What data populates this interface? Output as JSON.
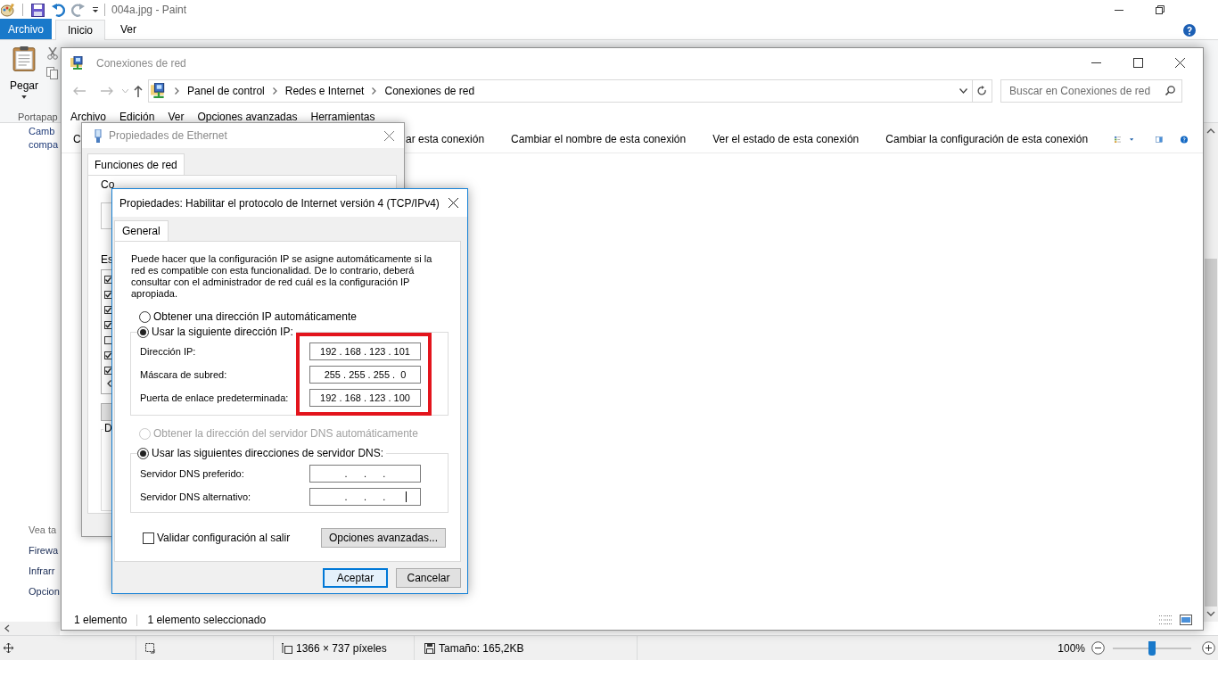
{
  "paint": {
    "title": "004a.jpg - Paint",
    "tabs": [
      {
        "label": "Archivo",
        "kind": "file"
      },
      {
        "label": "Inicio",
        "kind": "tab",
        "selected": true
      },
      {
        "label": "Ver",
        "kind": "tab",
        "selected": false
      }
    ],
    "ribbon": {
      "paste_label": "Pegar",
      "group_label": "Portapap"
    },
    "status_bar": {
      "dimensions": "1366 × 737 píxeles",
      "size": "Tamaño: 165,2KB",
      "zoom": {
        "reading": "100%",
        "level": 0.5
      }
    }
  },
  "background_window": {
    "top_lines": [
      "Camb",
      "compa"
    ],
    "see_also": {
      "heading": "Vea ta",
      "links": [
        "Firewa",
        "Infrarr",
        "Opcion"
      ]
    }
  },
  "explorer": {
    "title": "Conexiones de red",
    "breadcrumb": [
      "Panel de control",
      "Redes e Internet",
      "Conexiones de red"
    ],
    "search": {
      "placeholder": "Buscar en Conexiones de red"
    },
    "menu": [
      "Archivo",
      "Edición",
      "Ver",
      "Opciones avanzadas",
      "Herramientas"
    ],
    "commands": [
      "C",
      "ar esta conexión",
      "Cambiar el nombre de esta conexión",
      "Ver el estado de esta conexión",
      "Cambiar la configuración de esta conexión"
    ],
    "status": [
      "1 elemento",
      "1 elemento seleccionado"
    ]
  },
  "ethernet_dialog": {
    "title": "Propiedades de Ethernet",
    "tab": {
      "label": "Funciones de red",
      "selected": true
    },
    "labels": [
      "Co",
      "Es",
      "D"
    ],
    "components": [
      {
        "checked": true
      },
      {
        "checked": true
      },
      {
        "checked": true
      },
      {
        "checked": true
      },
      {
        "checked": false
      },
      {
        "checked": true
      },
      {
        "checked": true
      }
    ]
  },
  "ipv4_dialog": {
    "title": "Propiedades: Habilitar el protocolo de Internet versión 4 (TCP/IPv4)",
    "tab": {
      "label": "General",
      "selected": true
    },
    "description": "Puede hacer que la configuración IP se asigne automáticamente si la red es compatible con esta funcionalidad. De lo contrario, deberá consultar con el administrador de red cuál es la configuración IP apropiada.",
    "ip_mode": [
      {
        "label": "Obtener una dirección IP automáticamente",
        "selected": false,
        "disabled": false
      },
      {
        "label": "Usar la siguiente dirección IP:",
        "selected": true,
        "disabled": false
      }
    ],
    "ip_fields": [
      {
        "label": "Dirección IP:",
        "value": "192 . 168 . 123 . 101",
        "focused": false
      },
      {
        "label": "Máscara de subred:",
        "value": "255 . 255 . 255 .  0",
        "focused": false
      },
      {
        "label": "Puerta de enlace predeterminada:",
        "value": "192 . 168 . 123 . 100",
        "focused": false
      }
    ],
    "dns_mode": [
      {
        "label": "Obtener la dirección del servidor DNS automáticamente",
        "selected": false,
        "disabled": true
      },
      {
        "label": "Usar las siguientes direcciones de servidor DNS:",
        "selected": true,
        "disabled": false
      }
    ],
    "dns_fields": [
      {
        "label": "Servidor DNS preferido:",
        "value": ".      .      .",
        "focused": false
      },
      {
        "label": "Servidor DNS alternativo:",
        "value": ".      .      .",
        "focused": true
      }
    ],
    "validate": {
      "label": "Validar configuración al salir",
      "checked": false
    },
    "advanced_button": "Opciones avanzadas...",
    "buttons": [
      {
        "label": "Aceptar",
        "kind": "default"
      },
      {
        "label": "Cancelar",
        "kind": "normal"
      }
    ]
  }
}
